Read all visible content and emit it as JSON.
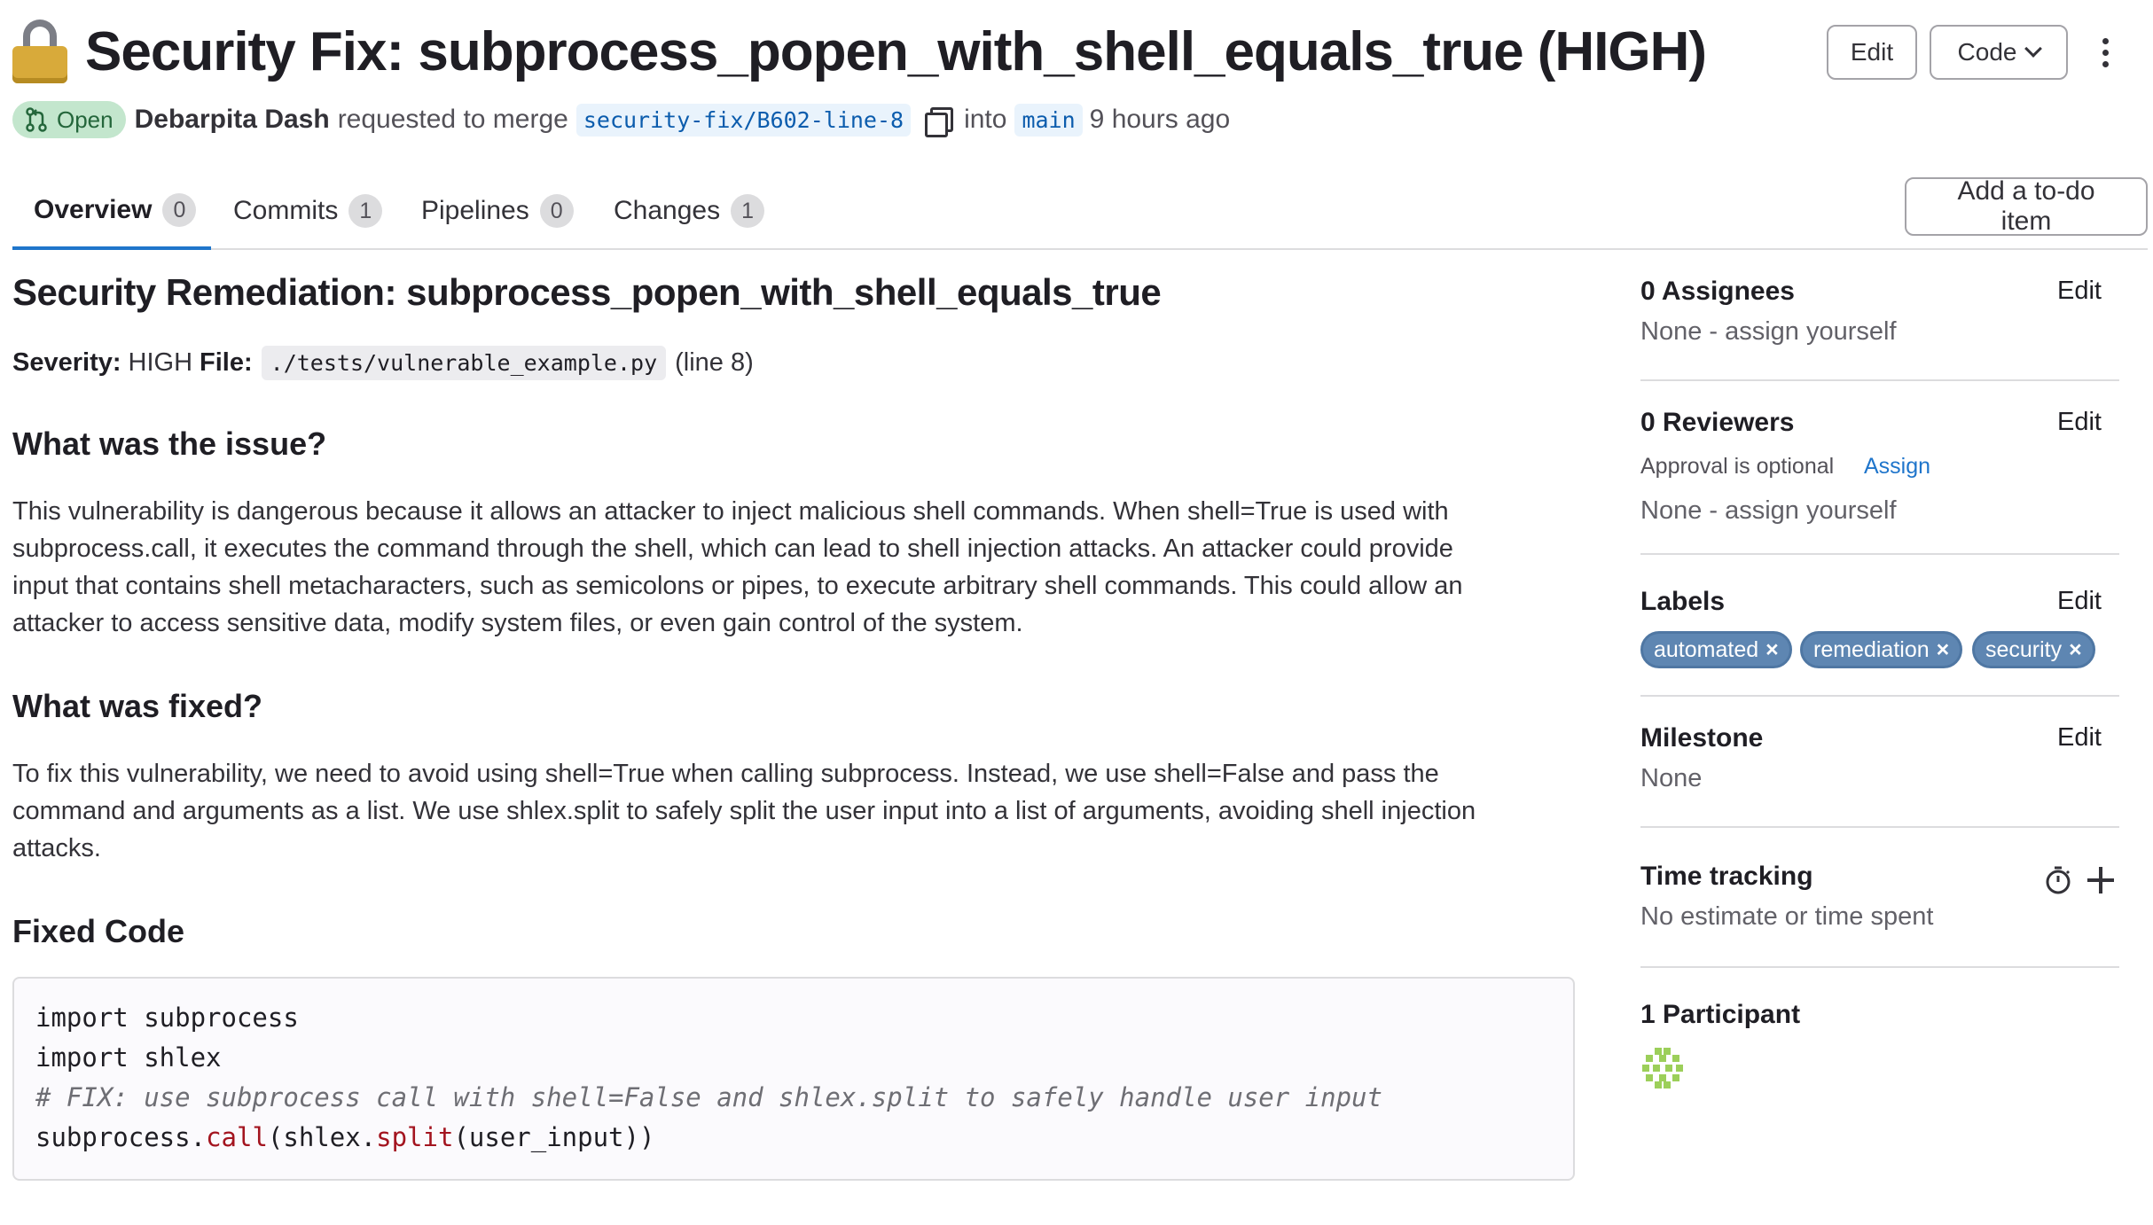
{
  "header": {
    "title": "Security Fix: subprocess_popen_with_shell_equals_true (HIGH)",
    "edit_label": "Edit",
    "code_label": "Code"
  },
  "meta": {
    "status": "Open",
    "author": "Debarpita Dash",
    "requested_text": "requested to merge",
    "source_branch": "security-fix/B602-line-8",
    "into_text": "into",
    "target_branch": "main",
    "time_ago": "9 hours ago"
  },
  "tabs": [
    {
      "label": "Overview",
      "count": "0"
    },
    {
      "label": "Commits",
      "count": "1"
    },
    {
      "label": "Pipelines",
      "count": "0"
    },
    {
      "label": "Changes",
      "count": "1"
    }
  ],
  "todo_label": "Add a to-do item",
  "description": {
    "heading": "Security Remediation: subprocess_popen_with_shell_equals_true",
    "severity_key": "Severity:",
    "severity_value": "HIGH",
    "file_key": "File:",
    "file_path": "./tests/vulnerable_example.py",
    "line_note": "(line 8)",
    "issue_heading": "What was the issue?",
    "issue_lines": [
      "This vulnerability is dangerous because it allows an attacker to inject malicious shell commands. When shell=True is used with",
      "subprocess.call, it executes the command through the shell, which can lead to shell injection attacks. An attacker could provide",
      "input that contains shell metacharacters, such as semicolons or pipes, to execute arbitrary shell commands. This could allow an",
      "attacker to access sensitive data, modify system files, or even gain control of the system."
    ],
    "fixed_heading": "What was fixed?",
    "fixed_lines": [
      "To fix this vulnerability, we need to avoid using shell=True when calling subprocess. Instead, we use shell=False and pass the",
      "command and arguments as a list. We use shlex.split to safely split the user input into a list of arguments, avoiding shell injection",
      "attacks."
    ],
    "code_heading": "Fixed Code",
    "code": {
      "line1": "import subprocess",
      "line2": "import shlex",
      "comment": "# FIX: use subprocess call with shell=False and shlex.split to safely handle user input",
      "call_prefix": "subprocess.",
      "call_fn": "call",
      "call_mid": "(shlex.",
      "split_fn": "split",
      "call_suffix": "(user_input))"
    }
  },
  "sidebar": {
    "assignees_title": "0 Assignees",
    "assignees_value": "None - assign yourself",
    "reviewers_title": "0 Reviewers",
    "approval_text": "Approval is optional",
    "assign_link": "Assign",
    "reviewers_value": "None - assign yourself",
    "labels_title": "Labels",
    "labels": [
      "automated",
      "remediation",
      "security"
    ],
    "milestone_title": "Milestone",
    "milestone_value": "None",
    "time_title": "Time tracking",
    "time_value": "No estimate or time spent",
    "participants_title": "1 Participant",
    "edit_label": "Edit"
  },
  "colors": {
    "accent": "#1f75cb",
    "status_green_bg": "#c3e6cd",
    "label_bg": "#5e86b2",
    "code_fn": "#a3141f"
  }
}
